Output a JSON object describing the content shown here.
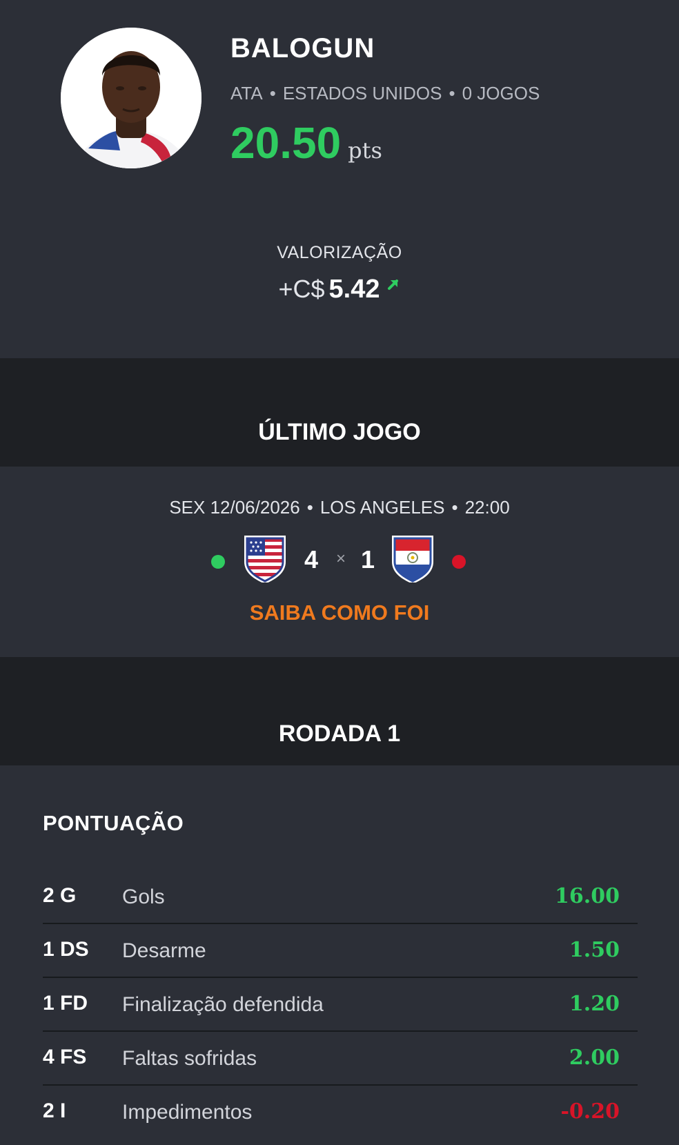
{
  "player": {
    "name": "BALOGUN",
    "position": "ATA",
    "country": "ESTADOS UNIDOS",
    "games": "0 JOGOS",
    "separator": "•",
    "points": "20.50",
    "points_unit": "pts"
  },
  "valorizacao": {
    "label": "VALORIZAÇÃO",
    "prefix": "+C$",
    "amount": "5.42",
    "trend": "up-arrow-icon"
  },
  "last_game": {
    "section_title": "ÚLTIMO JOGO",
    "day": "SEX 12/06/2026",
    "city": "LOS ANGELES",
    "time": "22:00",
    "separator": "•",
    "home_score": "4",
    "score_separator": "×",
    "away_score": "1",
    "home_team_icon": "usa-shield-icon",
    "away_team_icon": "paraguay-shield-icon",
    "link_label": "SAIBA COMO FOI"
  },
  "round": {
    "section_title": "RODADA 1",
    "scores_title": "PONTUAÇÃO",
    "rows": [
      {
        "code": "2 G",
        "label": "Gols",
        "value": "16.00"
      },
      {
        "code": "1 DS",
        "label": "Desarme",
        "value": "1.50"
      },
      {
        "code": "1 FD",
        "label": "Finalização defendida",
        "value": "1.20"
      },
      {
        "code": "4 FS",
        "label": "Faltas sofridas",
        "value": "2.00"
      },
      {
        "code": "2 I",
        "label": "Impedimentos",
        "value": "-0.20"
      }
    ]
  },
  "colors": {
    "positive": "#2fcc60",
    "negative": "#d81428",
    "accent": "#f07a1e",
    "background": "#2c2f37",
    "section_header": "#1e2024"
  }
}
